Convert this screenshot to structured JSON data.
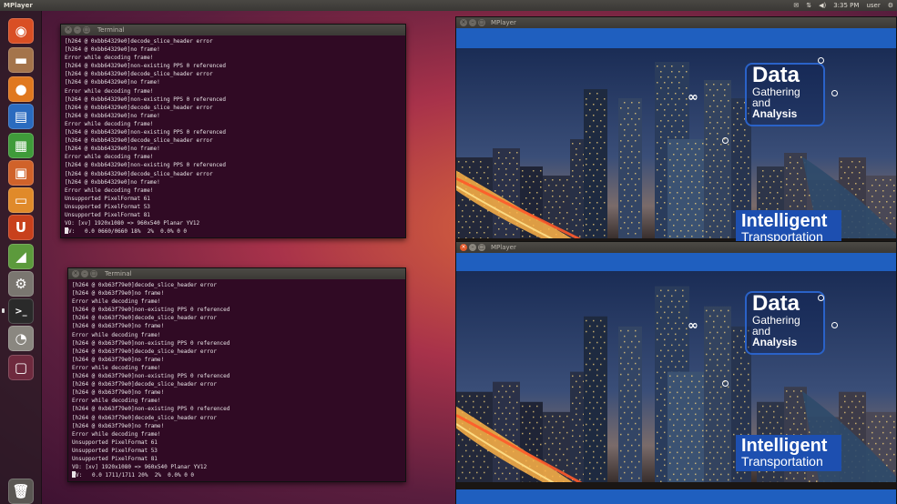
{
  "topbar": {
    "app_title": "MPlayer",
    "indicators": [
      "✉",
      "⇅",
      "◀)",
      "3:35 PM",
      "user",
      "⚙"
    ]
  },
  "launcher": {
    "items": [
      {
        "icon": "ubuntu-dash-icon",
        "glyph": "◉",
        "color": "#d94f24"
      },
      {
        "icon": "files-icon",
        "glyph": "▬",
        "color": "#a4744b"
      },
      {
        "icon": "firefox-icon",
        "glyph": "●",
        "color": "#e0781f"
      },
      {
        "icon": "writer-icon",
        "glyph": "▤",
        "color": "#2a6bbf"
      },
      {
        "icon": "calc-icon",
        "glyph": "▦",
        "color": "#3f9b3a"
      },
      {
        "icon": "impress-icon",
        "glyph": "▣",
        "color": "#d0622a"
      },
      {
        "icon": "software-center-icon",
        "glyph": "▭",
        "color": "#e08a2a"
      },
      {
        "icon": "ubuntu-one-icon",
        "glyph": "U",
        "color": "#c8401c"
      },
      {
        "icon": "system-monitor-icon",
        "glyph": "◢",
        "color": "#5c9a3c"
      },
      {
        "icon": "settings-icon",
        "glyph": "⚙",
        "color": "#7a7670"
      },
      {
        "icon": "terminal-icon",
        "glyph": ">_",
        "color": "#2a2a2a"
      },
      {
        "icon": "disk-icon",
        "glyph": "◔",
        "color": "#8a8780"
      },
      {
        "icon": "workspace-icon",
        "glyph": "▢",
        "color": "#6e2a3e"
      },
      {
        "icon": "trash-icon",
        "glyph": "🗑",
        "color": "#5a5753"
      }
    ]
  },
  "terminal_top": {
    "title": "Terminal",
    "lines": [
      "[h264 @ 0xbb64329e0]decode_slice_header error",
      "[h264 @ 0xbb64329e0]no frame!",
      "Error while decoding frame!",
      "[h264 @ 0xbb64329e0]non-existing PPS 0 referenced",
      "[h264 @ 0xbb64329e0]decode_slice_header error",
      "[h264 @ 0xbb64329e0]no frame!",
      "Error while decoding frame!",
      "[h264 @ 0xbb64329e0]non-existing PPS 0 referenced",
      "[h264 @ 0xbb64329e0]decode_slice_header error",
      "[h264 @ 0xbb64329e0]no frame!",
      "Error while decoding frame!",
      "[h264 @ 0xbb64329e0]non-existing PPS 0 referenced",
      "[h264 @ 0xbb64329e0]decode_slice_header error",
      "[h264 @ 0xbb64329e0]no frame!",
      "Error while decoding frame!",
      "[h264 @ 0xbb64329e0]non-existing PPS 0 referenced",
      "[h264 @ 0xbb64329e0]decode_slice_header error",
      "[h264 @ 0xbb64329e0]no frame!",
      "Error while decoding frame!",
      "Unsupported PixelFormat 61",
      "Unsupported PixelFormat 53",
      "Unsupported PixelFormat 81",
      "VO: [xv] 1920x1080 => 960x540 Planar YV12",
      "V:   0.0 0660/0660 18%  2%  0.0% 0 0"
    ]
  },
  "terminal_bottom": {
    "title": "Terminal",
    "lines": [
      "[h264 @ 0xb63f79e0]decode_slice_header error",
      "[h264 @ 0xb63f79e0]no frame!",
      "Error while decoding frame!",
      "[h264 @ 0xb63f79e0]non-existing PPS 0 referenced",
      "[h264 @ 0xb63f79e0]decode_slice_header error",
      "[h264 @ 0xb63f79e0]no frame!",
      "Error while decoding frame!",
      "[h264 @ 0xb63f79e0]non-existing PPS 0 referenced",
      "[h264 @ 0xb63f79e0]decode_slice_header error",
      "[h264 @ 0xb63f79e0]no frame!",
      "Error while decoding frame!",
      "[h264 @ 0xb63f79e0]non-existing PPS 0 referenced",
      "[h264 @ 0xb63f79e0]decode_slice_header error",
      "[h264 @ 0xb63f79e0]no frame!",
      "Error while decoding frame!",
      "[h264 @ 0xb63f79e0]non-existing PPS 0 referenced",
      "[h264 @ 0xb63f79e0]decode_slice_header error",
      "[h264 @ 0xb63f79e0]no frame!",
      "Error while decoding frame!",
      "Unsupported PixelFormat 61",
      "Unsupported PixelFormat 53",
      "Unsupported PixelFormat 81",
      "VO: [xv] 1920x1080 => 960x540 Planar YV12",
      "V:   0.0 1711/1711 20%  2%  0.0% 0 0"
    ]
  },
  "mplayer_top": {
    "title": "MPlayer",
    "data_big": "Data",
    "data_small_1": "Gathering",
    "data_small_2": "and",
    "data_small_3": "Analysis",
    "it_big": "Intelligent",
    "it_small": "Transportation"
  },
  "mplayer_bottom": {
    "title": "MPlayer",
    "data_big": "Data",
    "data_small_1": "Gathering",
    "data_small_2": "and",
    "data_small_3": "Analysis",
    "it_big": "Intelligent",
    "it_small": "Transportation"
  }
}
